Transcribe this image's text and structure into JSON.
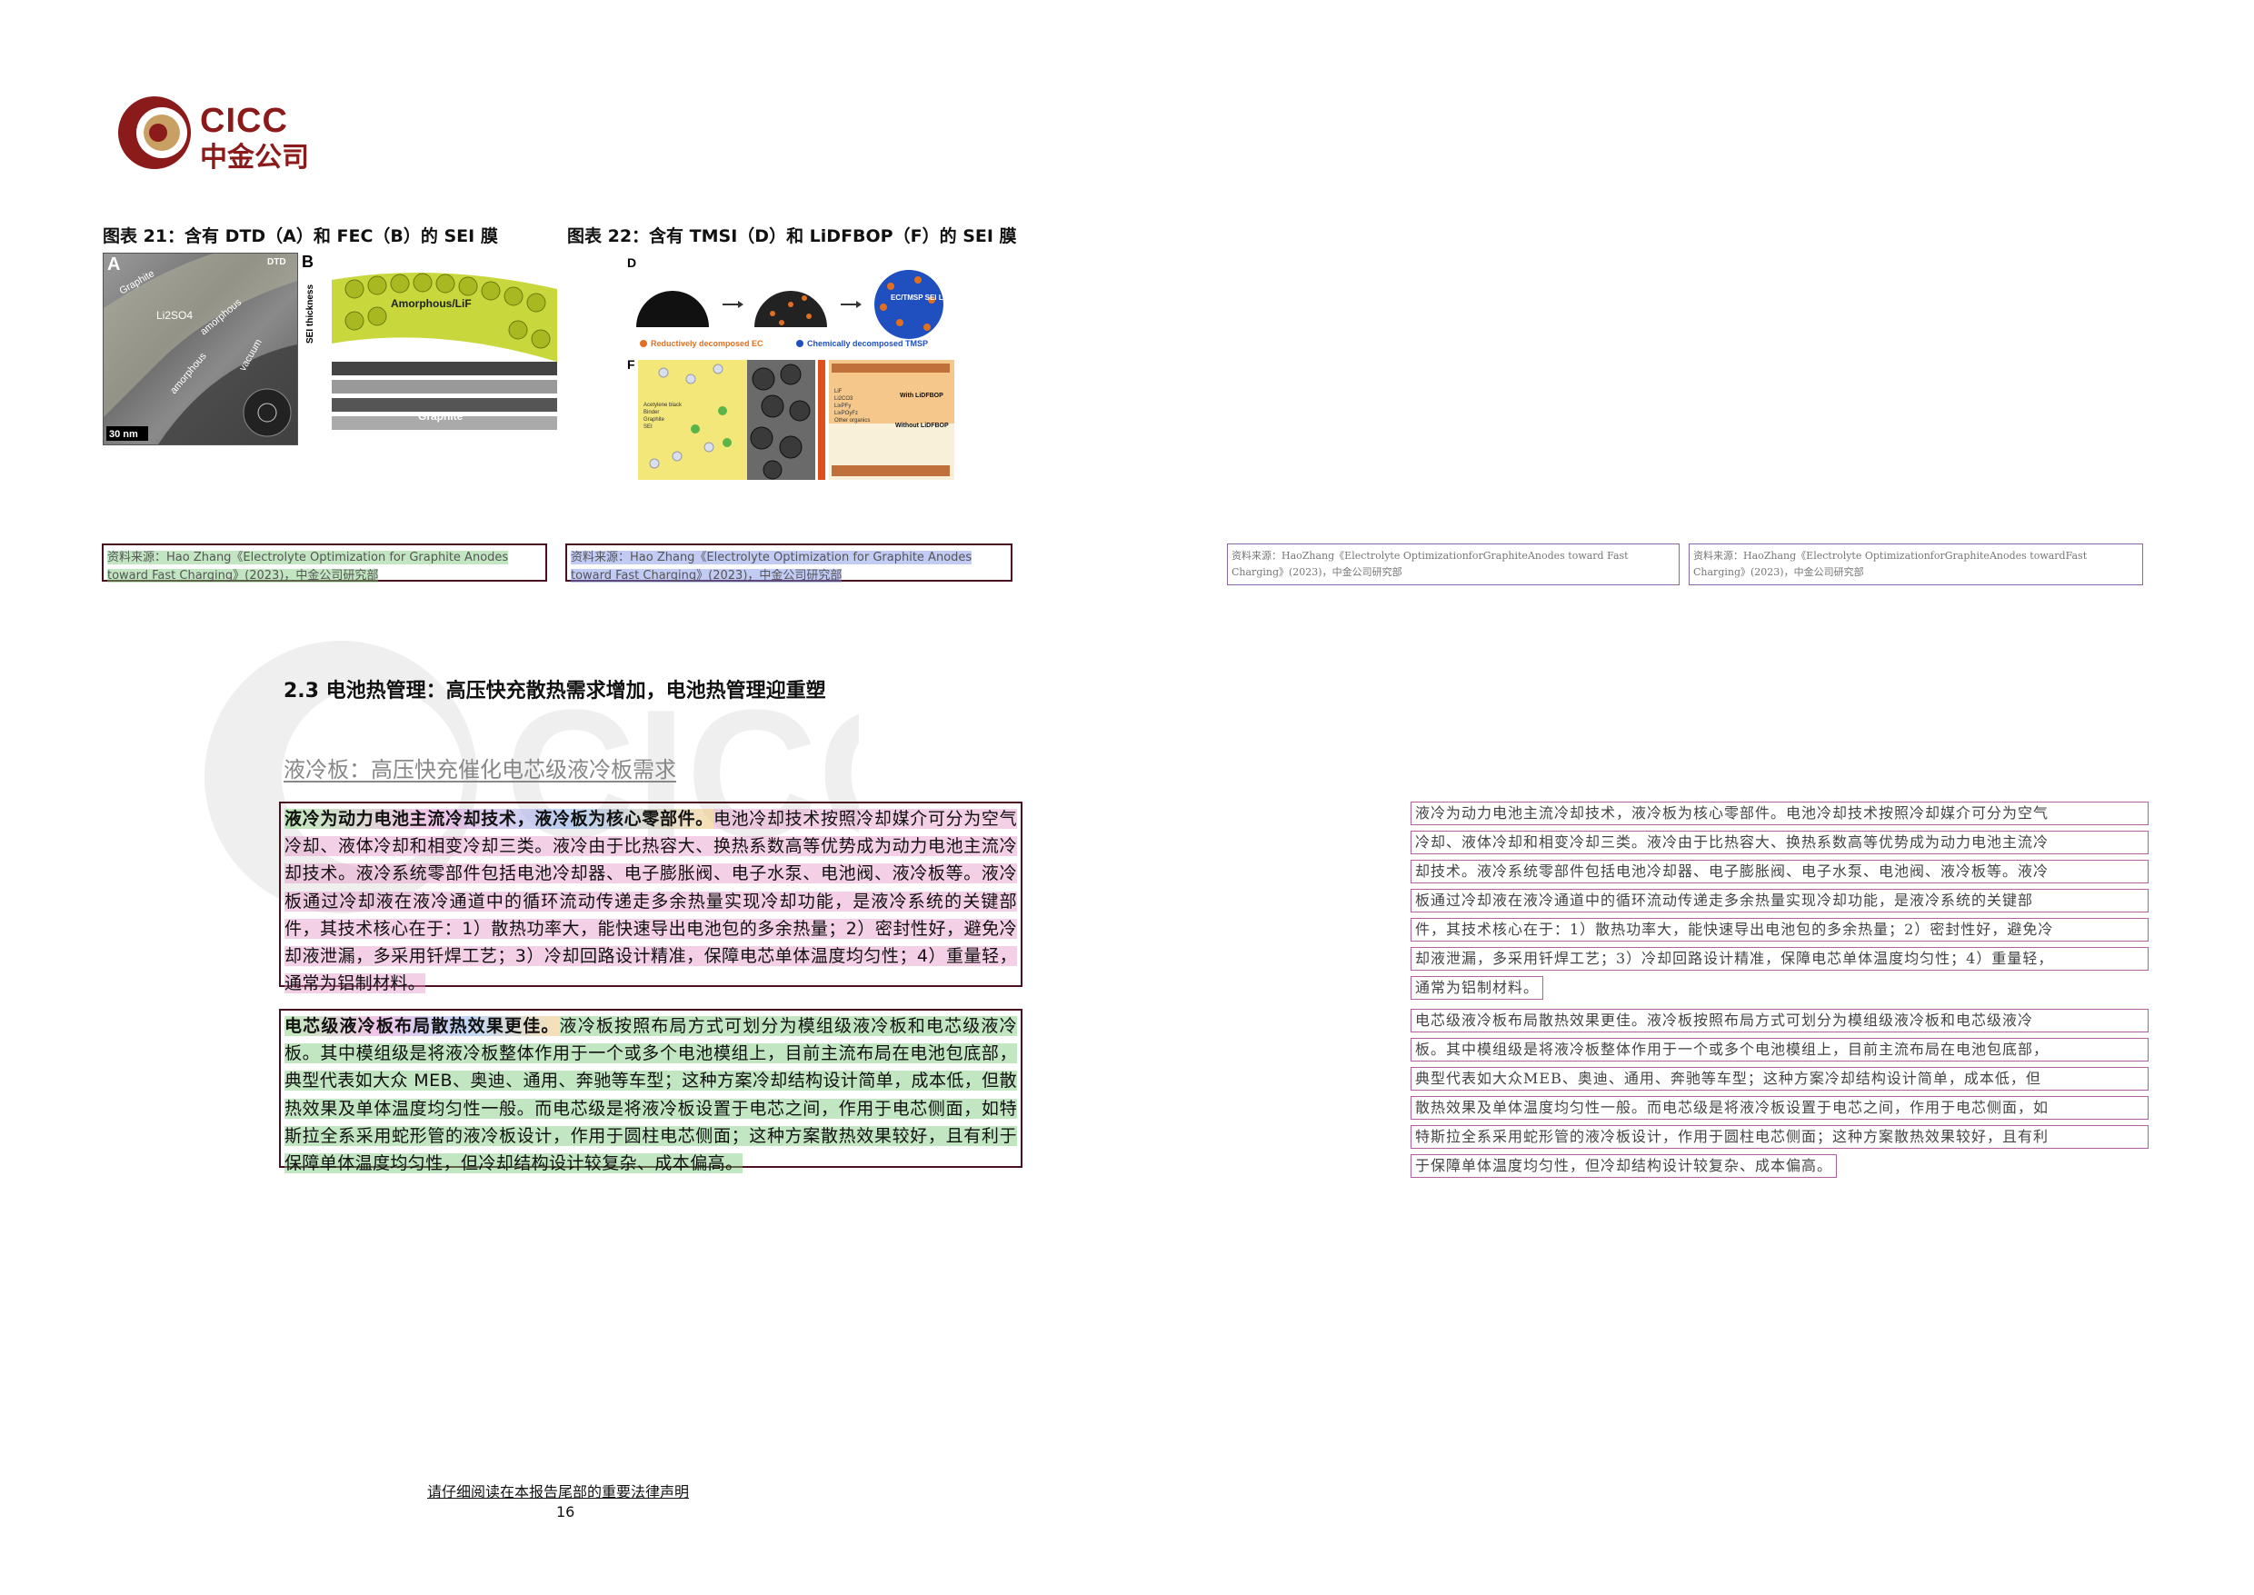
{
  "logo": {
    "en": "CICC",
    "cn": "中金公司"
  },
  "watermark": {
    "text": "CICC"
  },
  "figures": [
    {
      "title": "图表 21：含有 DTD（A）和 FEC（B）的 SEI 膜",
      "panel_a_letter": "A",
      "panel_b_letter": "B",
      "panel_a_labels": {
        "tag": "DTD",
        "graphite": "Graphite",
        "li2so4": "Li2SO4",
        "amorphous1": "amorphous",
        "amorphous2": "amorphous",
        "vacuum": "vacuum",
        "scale": "30 nm"
      },
      "panel_b_labels": {
        "thickness": "SEI thickness",
        "amorphous": "Amorphous/LiF",
        "graphite": "Graphite"
      },
      "source": "资料来源：Hao Zhang《Electrolyte Optimization for Graphite Anodes toward Fast Charging》(2023)，中金公司研究部"
    },
    {
      "title": "图表 22：含有 TMSI（D）和 LiDFBOP（F）的 SEI 膜",
      "panel_d_letter": "D",
      "panel_f_letter": "F",
      "panel_d_labels": {
        "layer": "EC/TMSP SEI Layer",
        "legend1": "Reductively decomposed EC",
        "legend2": "Chemically decomposed TMSP"
      },
      "panel_f_labels": {
        "with": "With LiDFBOP",
        "without": "Without LiDFBOP",
        "legend": [
          "Acetylene black",
          "Binder",
          "Graphite",
          "SEI"
        ],
        "legend_r": [
          "LiF",
          "Li2CO3",
          "LixPFy",
          "LixPOyFz",
          "Other organics"
        ]
      },
      "source": "资料来源：Hao Zhang《Electrolyte Optimization for Graphite Anodes toward Fast Charging》(2023)，中金公司研究部"
    }
  ],
  "right_sources": [
    {
      "line1": "资料来源：HaoZhang《Electrolyte OptimizationforGraphiteAnodes toward Fast",
      "line2": "Charging》(2023)，中金公司研究部"
    },
    {
      "line1": "资料来源：HaoZhang《Electrolyte OptimizationforGraphiteAnodes towardFast",
      "line2": "Charging》(2023)，中金公司研究部"
    }
  ],
  "section": {
    "heading": "2.3 电池热管理：高压快充散热需求增加，电池热管理迎重塑",
    "subheading": "液冷板：高压快充催化电芯级液冷板需求"
  },
  "paragraphs": [
    {
      "lead": "液冷为动力电池主流冷却技术，液冷板为核心零部件。",
      "body": "电池冷却技术按照冷却媒介可分为空气冷却、液体冷却和相变冷却三类。液冷由于比热容大、换热系数高等优势成为动力电池主流冷却技术。液冷系统零部件包括电池冷却器、电子膨胀阀、电子水泵、电池阀、液冷板等。液冷板通过冷却液在液冷通道中的循环流动传递走多余热量实现冷却功能，是液冷系统的关键部件，其技术核心在于：1）散热功率大，能快速导出电池包的多余热量；2）密封性好，避免冷却液泄漏，多采用钎焊工艺；3）冷却回路设计精准，保障电芯单体温度均匀性；4）重量轻，通常为铝制材料。"
    },
    {
      "lead": "电芯级液冷板布局散热效果更佳。",
      "body": "液冷板按照布局方式可划分为模组级液冷板和电芯级液冷板。其中模组级是将液冷板整体作用于一个或多个电池模组上，目前主流布局在电池包底部，典型代表如大众 MEB、奥迪、通用、奔驰等车型；这种方案冷却结构设计简单，成本低，但散热效果及单体温度均匀性一般。而电芯级是将液冷板设置于电芯之间，作用于电芯侧面，如特斯拉全系采用蛇形管的液冷板设计，作用于圆柱电芯侧面；这种方案散热效果较好，且有利于保障单体温度均匀性，但冷却结构设计较复杂、成本偏高。"
    }
  ],
  "right_paragraphs": [
    {
      "lines": [
        "液冷为动力电池主流冷却技术，液冷板为核心零部件。电池冷却技术按照冷却媒介可分为空气",
        "冷却、液体冷却和相变冷却三类。液冷由于比热容大、换热系数高等优势成为动力电池主流冷",
        "却技术。液冷系统零部件包括电池冷却器、电子膨胀阀、电子水泵、电池阀、液冷板等。液冷",
        "板通过冷却液在液冷通道中的循环流动传递走多余热量实现冷却功能，是液冷系统的关键部",
        "件，其技术核心在于：1）散热功率大，能快速导出电池包的多余热量；2）密封性好，避免冷",
        "却液泄漏，多采用钎焊工艺；3）冷却回路设计精准，保障电芯单体温度均匀性；4）重量轻，",
        "通常为铝制材料。"
      ]
    },
    {
      "lines": [
        "电芯级液冷板布局散热效果更佳。液冷板按照布局方式可划分为模组级液冷板和电芯级液冷",
        "板。其中模组级是将液冷板整体作用于一个或多个电池模组上，目前主流布局在电池包底部，",
        "典型代表如大众MEB、奥迪、通用、奔驰等车型；这种方案冷却结构设计简单，成本低，但",
        "散热效果及单体温度均匀性一般。而电芯级是将液冷板设置于电芯之间，作用于电芯侧面，如",
        "特斯拉全系采用蛇形管的液冷板设计，作用于圆柱电芯侧面；这种方案散热效果较好，且有利",
        "于保障单体温度均匀性，但冷却结构设计较复杂、成本偏高。"
      ]
    }
  ],
  "footer": {
    "note": "请仔细阅读在本报告尾部的重要法律声明",
    "page": "16"
  },
  "colors": {
    "brand": "#8b1a1a",
    "box_border": "#4a1020"
  }
}
